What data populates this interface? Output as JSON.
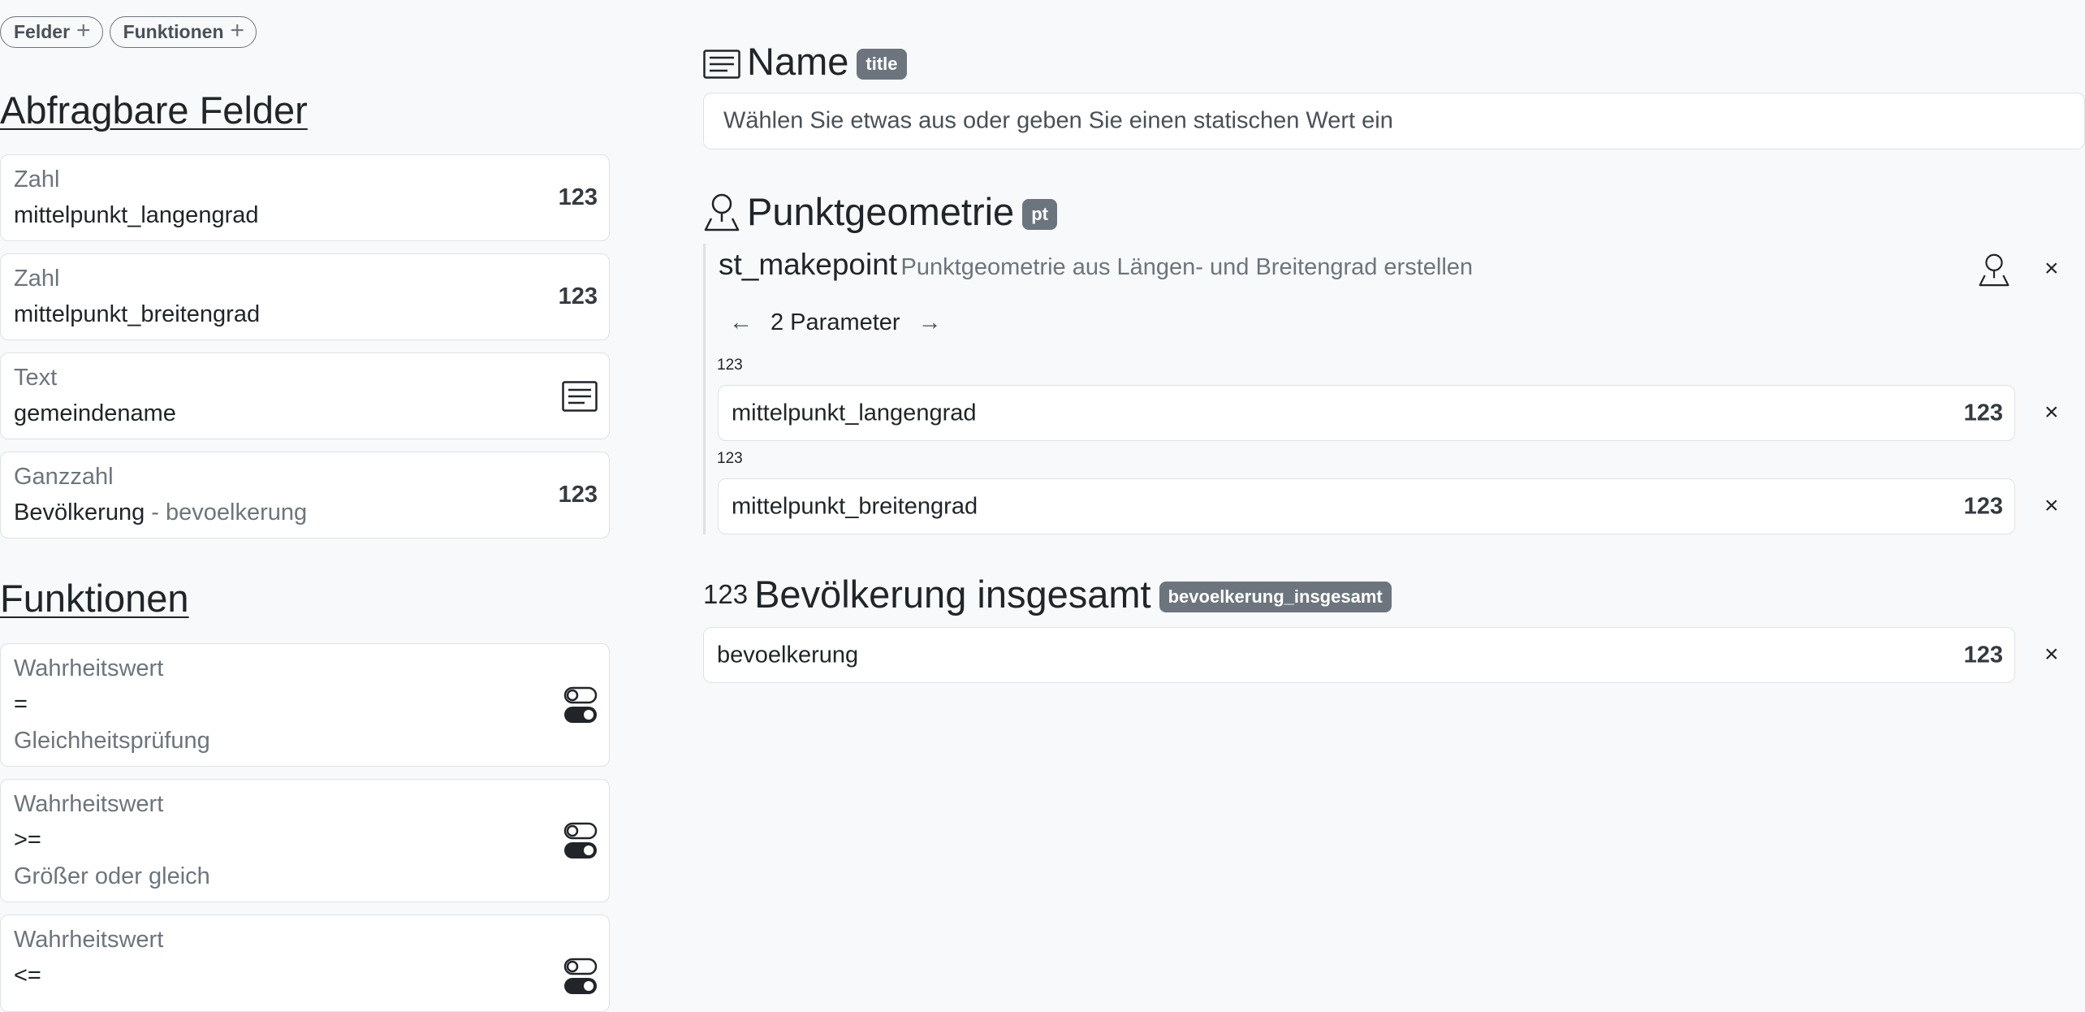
{
  "top_pills": [
    {
      "label": "Felder"
    },
    {
      "label": "Funktionen"
    }
  ],
  "fields_section": {
    "title": "Abfragbare Felder",
    "items": [
      {
        "type": "Zahl",
        "value": "mittelpunkt_langengrad",
        "suffix": "",
        "badge": "123",
        "icon": "number-icon"
      },
      {
        "type": "Zahl",
        "value": "mittelpunkt_breitengrad",
        "suffix": "",
        "badge": "123",
        "icon": "number-icon"
      },
      {
        "type": "Text",
        "value": "gemeindename",
        "suffix": "",
        "badge": "",
        "icon": "text-lines-icon"
      },
      {
        "type": "Ganzzahl",
        "value": "Bevölkerung",
        "suffix": " - bevoelkerung",
        "badge": "123",
        "icon": "number-icon"
      }
    ]
  },
  "functions_section": {
    "title": "Funktionen",
    "items": [
      {
        "type": "Wahrheitswert",
        "symbol": "=",
        "name": "Gleichheitsprüfung",
        "icon": "toggle-icon"
      },
      {
        "type": "Wahrheitswert",
        "symbol": ">=",
        "name": "Größer oder gleich",
        "icon": "toggle-icon"
      },
      {
        "type": "Wahrheitswert",
        "symbol": "<=",
        "name": "",
        "icon": "toggle-icon"
      }
    ]
  },
  "name_field": {
    "title": "Name",
    "tag": "title",
    "placeholder": "Wählen Sie etwas aus oder geben Sie einen statischen Wert ein"
  },
  "point_field": {
    "title": "Punktgeometrie",
    "tag": "pt",
    "function_name": "st_makepoint",
    "function_desc": "Punktgeometrie aus Längen- und Breitengrad erstellen",
    "nav_prev": "←",
    "nav_label": "2 Parameter",
    "nav_next": "→",
    "params": [
      {
        "type_label": "123",
        "value": "mittelpunkt_langengrad",
        "badge": "123"
      },
      {
        "type_label": "123",
        "value": "mittelpunkt_breitengrad",
        "badge": "123"
      }
    ]
  },
  "population_field": {
    "prefix": "123",
    "title": "Bevölkerung insgesamt",
    "tag": "bevoelkerung_insgesamt",
    "value": "bevoelkerung",
    "badge": "123"
  },
  "close_symbol": "×",
  "plus_symbol": "+"
}
